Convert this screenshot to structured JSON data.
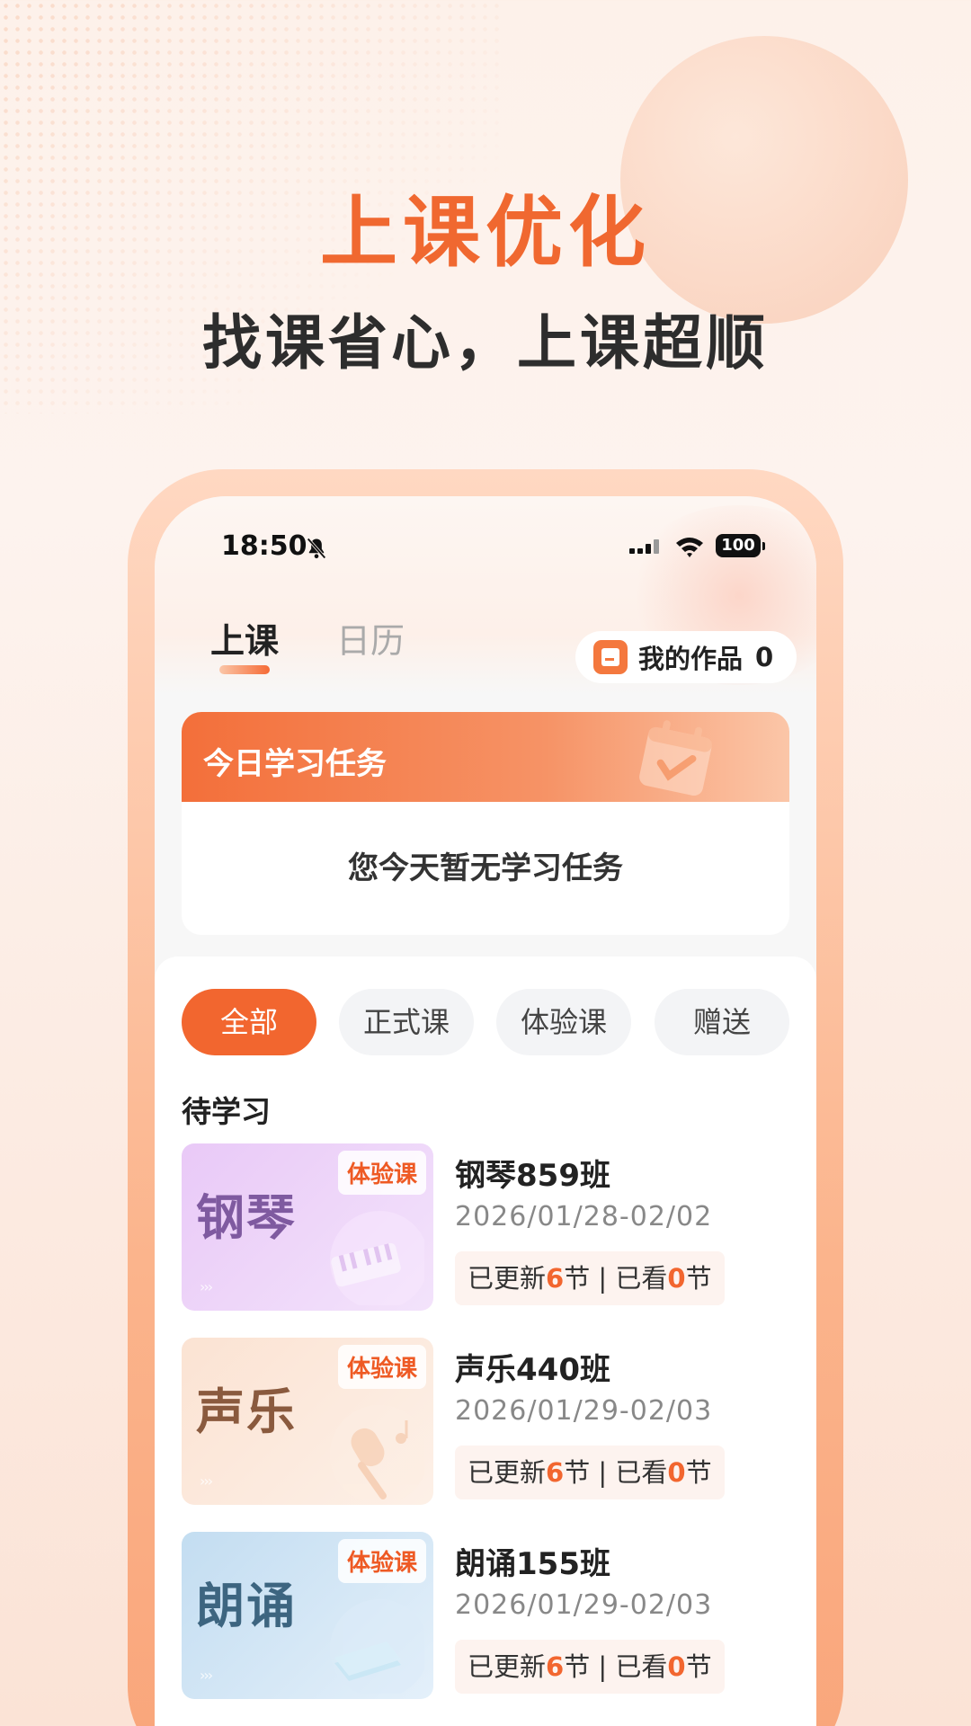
{
  "hero": {
    "title": "上课优化",
    "subtitle": "找课省心，上课超顺"
  },
  "status_bar": {
    "time": "18:50",
    "battery": "100",
    "icons": [
      "bell-muted-icon",
      "signal-icon",
      "wifi-icon",
      "battery-icon"
    ]
  },
  "top_tabs": [
    {
      "label": "上课",
      "active": true
    },
    {
      "label": "日历",
      "active": false
    }
  ],
  "works": {
    "label": "我的作品",
    "count": "0",
    "icon": "works-icon"
  },
  "task_card": {
    "title": "今日学习任务",
    "empty_text": "您今天暂无学习任务",
    "icon": "calendar-check-icon"
  },
  "filters": [
    {
      "label": "全部",
      "active": true
    },
    {
      "label": "正式课",
      "active": false
    },
    {
      "label": "体验课",
      "active": false
    },
    {
      "label": "赠送",
      "active": false
    }
  ],
  "section_label": "待学习",
  "courses": [
    {
      "thumb_title": "钢琴",
      "badge": "体验课",
      "name": "钢琴859班",
      "dates": "2026/01/28-02/02",
      "progress_prefix": "已更新",
      "updated": "6",
      "progress_mid": "节 | 已看",
      "watched": "0",
      "progress_suffix": "节",
      "arrow": "›››",
      "icon": "piano-icon",
      "colors": {
        "bg_start": "#e9c9f7",
        "bg_end": "#f3e3fb",
        "title": "#7f5aa0"
      }
    },
    {
      "thumb_title": "声乐",
      "badge": "体验课",
      "name": "声乐440班",
      "dates": "2026/01/29-02/03",
      "progress_prefix": "已更新",
      "updated": "6",
      "progress_mid": "节 | 已看",
      "watched": "0",
      "progress_suffix": "节",
      "arrow": "›››",
      "icon": "microphone-icon",
      "colors": {
        "bg_start": "#fbe3d3",
        "bg_end": "#fdf0e7",
        "title": "#8a5a3e"
      }
    },
    {
      "thumb_title": "朗诵",
      "badge": "体验课",
      "name": "朗诵155班",
      "dates": "2026/01/29-02/03",
      "progress_prefix": "已更新",
      "updated": "6",
      "progress_mid": "节 | 已看",
      "watched": "0",
      "progress_suffix": "节",
      "arrow": "›››",
      "icon": "book-icon",
      "colors": {
        "bg_start": "#c3ddf1",
        "bg_end": "#e4f0fa",
        "title": "#3d6580"
      }
    }
  ],
  "colors": {
    "accent": "#f2662f",
    "hero_title": "#f06830"
  }
}
